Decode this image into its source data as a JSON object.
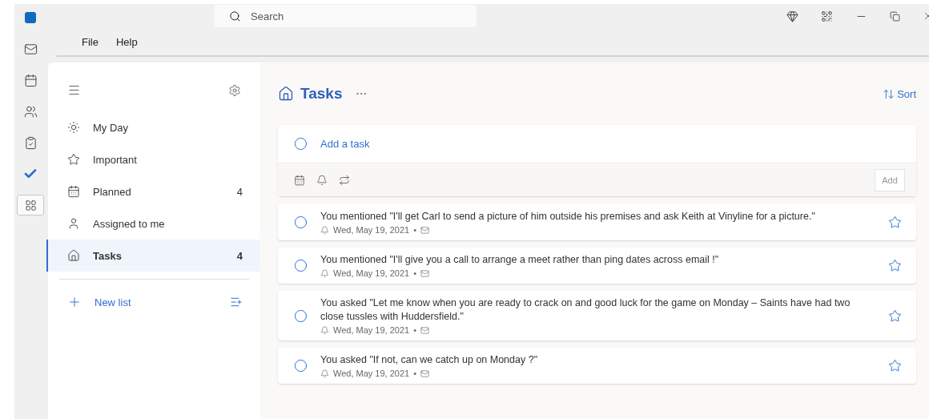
{
  "search": {
    "placeholder": "Search"
  },
  "rail": [
    {
      "kind": "logo",
      "selected": false
    },
    {
      "kind": "mail",
      "selected": false
    },
    {
      "kind": "calendar",
      "selected": false
    },
    {
      "kind": "people",
      "selected": false
    },
    {
      "kind": "clipboard",
      "selected": false
    },
    {
      "kind": "todo",
      "selected": false
    },
    {
      "kind": "apps",
      "selected": true
    }
  ],
  "menu": [
    "File",
    "Help"
  ],
  "sidebar": {
    "items": [
      {
        "kind": "sun",
        "label": "My Day",
        "selected": false
      },
      {
        "kind": "star",
        "label": "Important",
        "selected": false
      },
      {
        "kind": "calendar",
        "label": "Planned",
        "count": "4",
        "selected": false
      },
      {
        "kind": "person",
        "label": "Assigned to me",
        "selected": false
      },
      {
        "kind": "home",
        "label": "Tasks",
        "count": "4",
        "selected": true
      }
    ],
    "new_list": "New list"
  },
  "list": {
    "title": "Tasks",
    "sort": "Sort",
    "add_task": {
      "placeholder": "Add a task"
    },
    "add_button": "Add",
    "tasks": [
      {
        "text": "You mentioned \"I'll get Carl to send a picture of him outside his premises and ask Keith at Vinyline for a picture.\"",
        "date": "Wed, May 19, 2021",
        "separator": "•",
        "completed": false,
        "starred": false
      },
      {
        "text": "You mentioned \"I'll give you a call to arrange a meet rather than ping dates across email !\"",
        "date": "Wed, May 19, 2021",
        "separator": "•",
        "completed": false,
        "starred": false
      },
      {
        "text": "You asked \"Let me know when you are ready to crack on and good luck for the game on Monday – Saints have had two close tussles with Huddersfield.\"",
        "date": "Wed, May 19, 2021",
        "separator": "•",
        "completed": false,
        "starred": false
      },
      {
        "text": "You asked \"If not, can we catch up on Monday ?\"",
        "date": "Wed, May 19, 2021",
        "separator": "•",
        "completed": false,
        "starred": false
      }
    ]
  }
}
